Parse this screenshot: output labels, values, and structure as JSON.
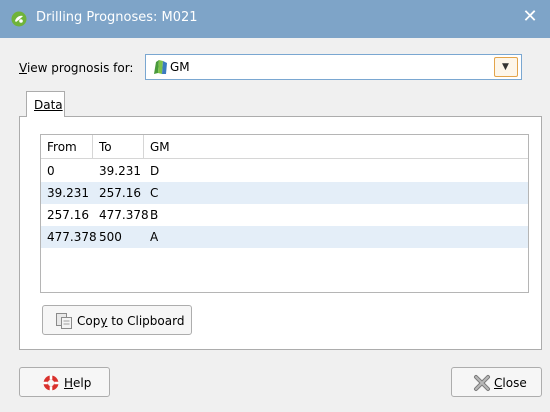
{
  "window": {
    "title": "Drilling Prognoses: M021",
    "close_glyph": "✕"
  },
  "view": {
    "label_prefix": "V",
    "label_rest": "iew prognosis for:",
    "selected": "GM",
    "dropdown_glyph": "▼"
  },
  "tabs": [
    {
      "label": "Data",
      "active": true
    }
  ],
  "table": {
    "columns": [
      "From",
      "To",
      "GM"
    ],
    "rows": [
      [
        "0",
        "39.231",
        "D"
      ],
      [
        "39.231",
        "257.16",
        "C"
      ],
      [
        "257.16",
        "477.378",
        "B"
      ],
      [
        "477.378",
        "500",
        "A"
      ]
    ]
  },
  "buttons": {
    "copy_pre": "Cop",
    "copy_ul": "y",
    "copy_post": " to Clipboard",
    "help_ul": "H",
    "help_rest": "elp",
    "close_ul": "C",
    "close_rest": "lose"
  },
  "icons": {
    "app": "leapfrog-app-icon",
    "combo_item": "geological-model-icon",
    "copy": "copy-clipboard-icon",
    "help": "help-lifebuoy-icon",
    "close": "close-cross-icon"
  },
  "colors": {
    "titlebar": "#7ea4c8",
    "alt_row": "#e4eef8",
    "combo_border": "#7aa7d1",
    "dropdown_border": "#e3a44a"
  }
}
